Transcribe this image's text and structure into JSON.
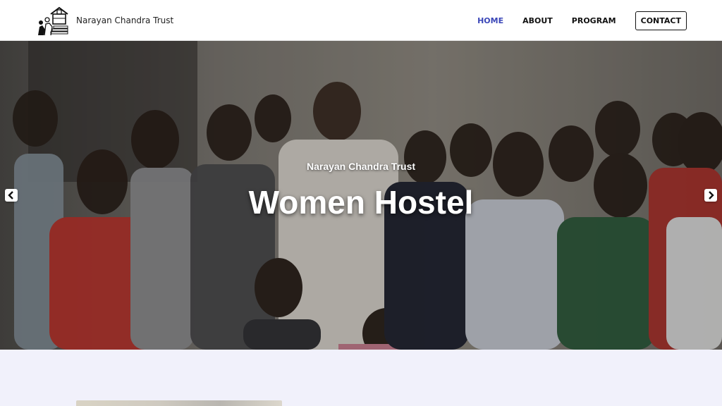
{
  "header": {
    "brand_name": "Narayan Chandra Trust",
    "logo_icon": "trust-logo-house-family"
  },
  "nav": {
    "items": [
      {
        "label": "HOME",
        "active": true
      },
      {
        "label": "ABOUT",
        "active": false
      },
      {
        "label": "PROGRAM",
        "active": false
      }
    ],
    "contact_label": "CONTACT",
    "active_color": "#3b47b8"
  },
  "hero": {
    "subtitle": "Narayan Chandra Trust",
    "title": "Women Hostel",
    "prev_icon": "chevron-left-icon",
    "next_icon": "chevron-right-icon",
    "photo_description_icon": "group-photo"
  }
}
